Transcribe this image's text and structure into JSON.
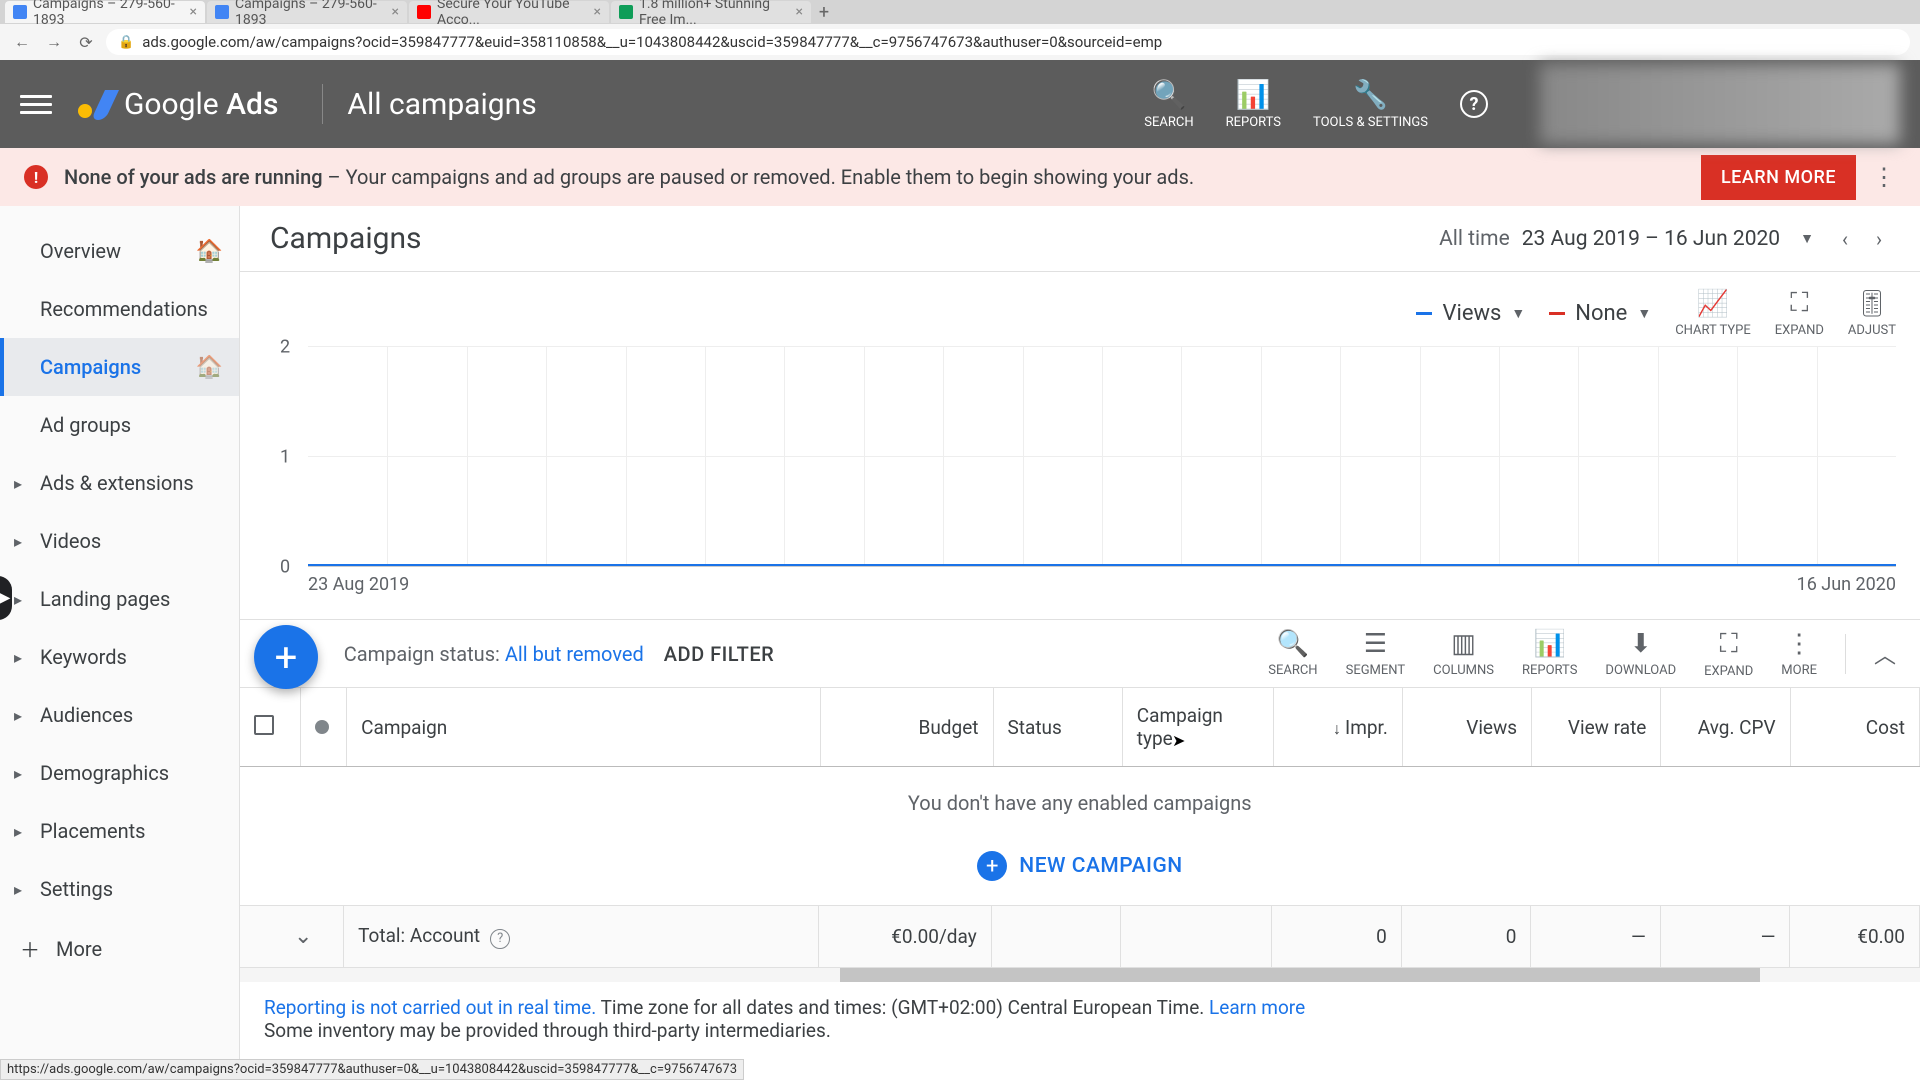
{
  "browser": {
    "tabs": [
      {
        "title": "Campaigns – 279-560-1893",
        "icon": "#4285f4"
      },
      {
        "title": "Campaigns – 279-560-1893",
        "icon": "#4285f4"
      },
      {
        "title": "Secure Your YouTube Acco...",
        "icon": "#ff0000"
      },
      {
        "title": "1.8 million+ Stunning Free Im...",
        "icon": "#0f9d58"
      }
    ],
    "url": "ads.google.com/aw/campaigns?ocid=359847777&euid=358110858&__u=1043808442&uscid=359847777&__c=9756747673&authuser=0&sourceid=emp"
  },
  "header": {
    "brand1": "Google",
    "brand2": "Ads",
    "context": "All campaigns",
    "actions": {
      "search": "SEARCH",
      "reports": "REPORTS",
      "tools": "TOOLS & SETTINGS"
    }
  },
  "alert": {
    "bold": "None of your ads are running",
    "rest": " – Your campaigns and ad groups are paused or removed. Enable them to begin showing your ads.",
    "button": "LEARN MORE"
  },
  "sidebar": {
    "items": [
      "Overview",
      "Recommendations",
      "Campaigns",
      "Ad groups",
      "Ads & extensions",
      "Videos",
      "Landing pages",
      "Keywords",
      "Audiences",
      "Demographics",
      "Placements",
      "Settings"
    ],
    "more": "More"
  },
  "content": {
    "title": "Campaigns",
    "date_label": "All time",
    "date_range": "23 Aug 2019 – 16 Jun 2020"
  },
  "chart_data": {
    "type": "line",
    "series": [
      {
        "name": "Views",
        "color": "#1a73e8",
        "values": [
          0,
          0
        ]
      },
      {
        "name": "None",
        "color": "#d93025",
        "values": []
      }
    ],
    "x_start": "23 Aug 2019",
    "x_end": "16 Jun 2020",
    "y_ticks": [
      0,
      1,
      2
    ],
    "ylim": [
      0,
      2
    ]
  },
  "chart_controls": {
    "metric1": "Views",
    "metric2": "None",
    "chart_type": "CHART TYPE",
    "expand": "EXPAND",
    "adjust": "ADJUST"
  },
  "table": {
    "filter_label": "Campaign status:",
    "filter_value": "All but removed",
    "add_filter": "ADD FILTER",
    "tools": {
      "search": "SEARCH",
      "segment": "SEGMENT",
      "columns": "COLUMNS",
      "reports": "REPORTS",
      "download": "DOWNLOAD",
      "expand": "EXPAND",
      "more": "MORE"
    },
    "columns": [
      "Campaign",
      "Budget",
      "Status",
      "Campaign type",
      "Impr.",
      "Views",
      "View rate",
      "Avg. CPV",
      "Cost"
    ],
    "empty_msg": "You don't have any enabled campaigns",
    "new_campaign": "NEW CAMPAIGN",
    "total_label": "Total: Account",
    "total_row": {
      "budget": "€0.00/day",
      "impr": "0",
      "views": "0",
      "view_rate": "—",
      "avg_cpv": "—",
      "cost": "€0.00"
    }
  },
  "footer": {
    "link1": "Reporting is not carried out in real time.",
    "text1": " Time zone for all dates and times: (GMT+02:00) Central European Time. ",
    "link2": "Learn more",
    "text2": "Some inventory may be provided through third-party intermediaries."
  },
  "status_link": "https://ads.google.com/aw/campaigns?ocid=359847777&authuser=0&__u=1043808442&uscid=359847777&__c=9756747673"
}
